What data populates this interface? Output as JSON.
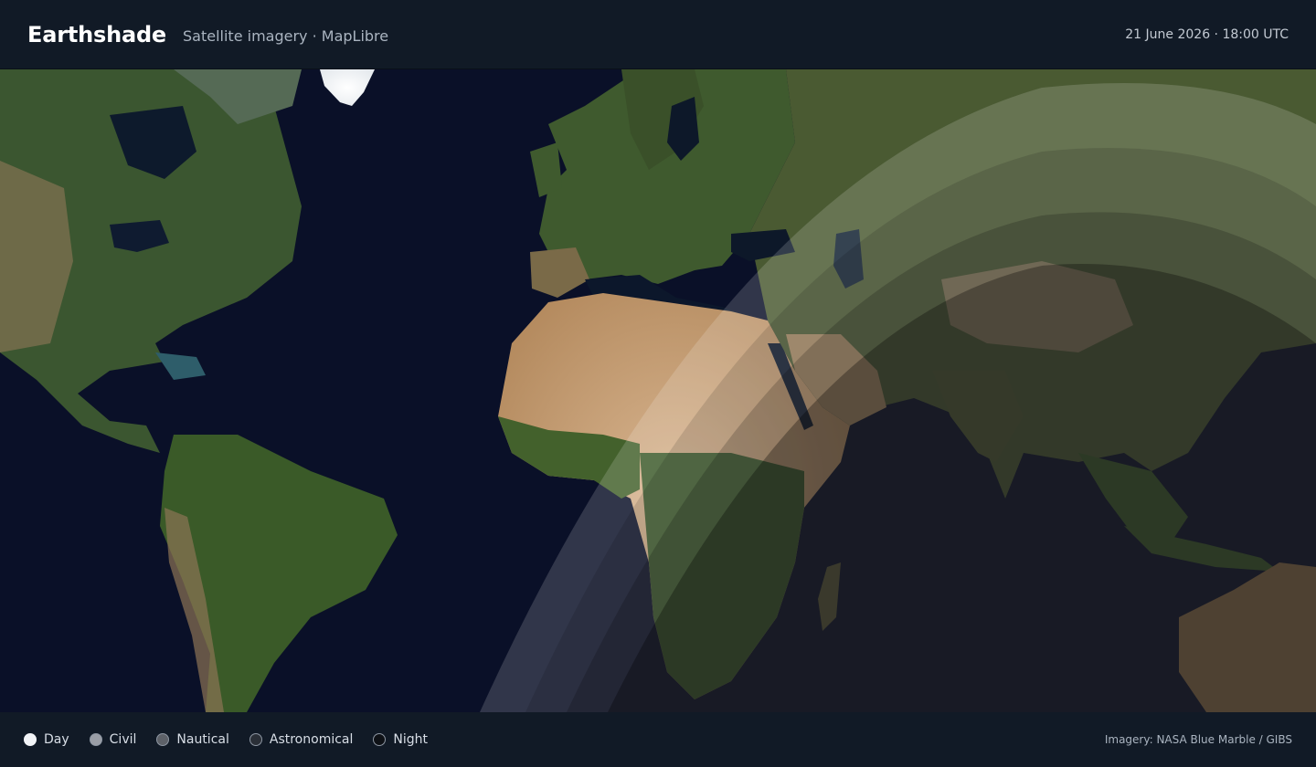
{
  "header": {
    "title": "Earthshade",
    "subtitle": "Satellite imagery · MapLibre",
    "timestamp": "21 June 2026 · 18:00 UTC"
  },
  "legend": {
    "items": [
      {
        "label": "Day",
        "color": "#f2f4f7"
      },
      {
        "label": "Civil",
        "color": "#9a9ea6"
      },
      {
        "label": "Nautical",
        "color": "#5d6168"
      },
      {
        "label": "Astronomical",
        "color": "#2a2f37"
      },
      {
        "label": "Night",
        "color": "#0e1116"
      }
    ]
  },
  "footer": {
    "attribution": "Imagery: NASA Blue Marble / GIBS"
  },
  "colors": {
    "ocean": "#0a1025",
    "vegetation": "#3d5a2a",
    "desert": "#c8a27a",
    "ice": "#f3f5f7",
    "chrome": "#111a26"
  }
}
